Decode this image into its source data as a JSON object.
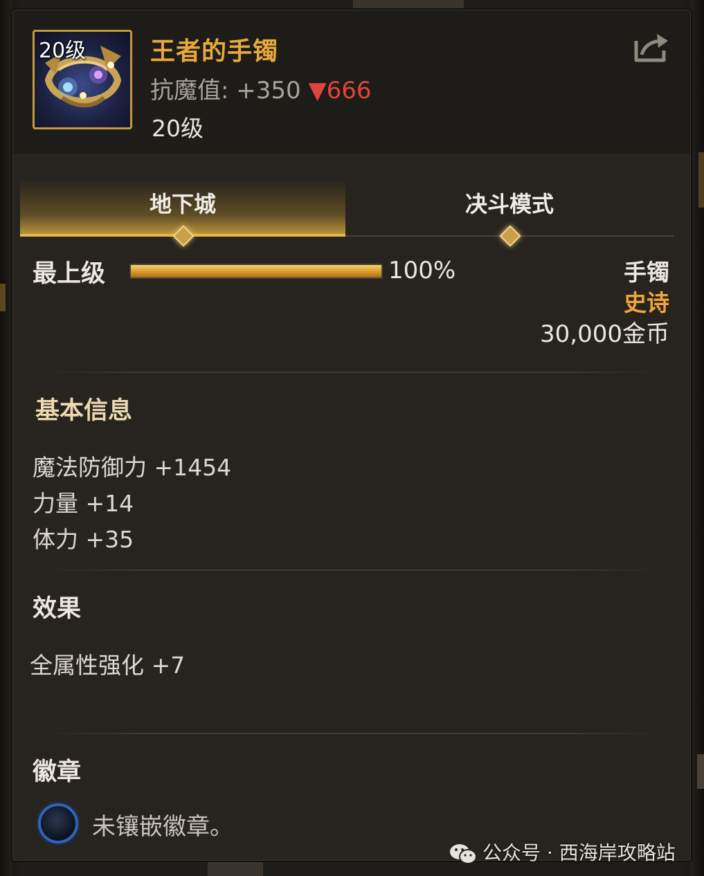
{
  "item": {
    "icon_level": "20级",
    "name": "王者的手镯",
    "stat_label": "抗魔值:",
    "stat_value": "+350",
    "stat_change": "▼666",
    "level": "20级"
  },
  "tabs": [
    {
      "label": "地下城",
      "active": true
    },
    {
      "label": "决斗模式",
      "active": false
    }
  ],
  "grade": {
    "label": "最上级",
    "percent": 100,
    "percent_text": "100%"
  },
  "meta": {
    "type": "手镯",
    "rarity": "史诗",
    "price": "30,000金币"
  },
  "sections": {
    "basic": {
      "title": "基本信息",
      "lines": [
        "魔法防御力 +1454",
        "力量 +14",
        "体力 +35"
      ]
    },
    "effect": {
      "title": "效果",
      "lines": [
        "全属性强化 +7"
      ]
    },
    "emblem": {
      "title": "徽章",
      "empty_text": "未镶嵌徽章。"
    }
  },
  "watermark": "公众号 · 西海岸攻略站",
  "colors": {
    "gold": "#e8a93c",
    "rarity": "#f0a53a",
    "down": "#e0443c",
    "panel": "#27241f"
  },
  "icons": [
    "bracelet-icon",
    "share-icon",
    "tab-diamond-icon",
    "badge-slot-icon",
    "wechat-icon"
  ]
}
